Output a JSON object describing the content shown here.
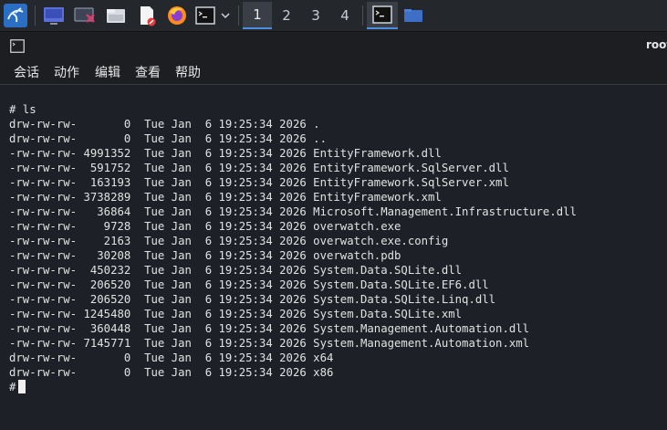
{
  "taskbar": {
    "apps": [
      {
        "icon": "kali-menu-icon"
      },
      {
        "icon": "show-desktop-icon"
      },
      {
        "icon": "screenshot-icon"
      },
      {
        "icon": "file-manager-icon"
      },
      {
        "icon": "text-editor-icon"
      },
      {
        "icon": "firefox-icon"
      },
      {
        "icon": "terminal-icon"
      },
      {
        "icon": "chevron-down-icon"
      }
    ],
    "workspaces": [
      "1",
      "2",
      "3",
      "4"
    ],
    "active_workspace": "1"
  },
  "window": {
    "title": "root"
  },
  "menu": [
    "会话",
    "动作",
    "编辑",
    "查看",
    "帮助"
  ],
  "terminal": {
    "command_line": "# ls",
    "rows": [
      {
        "perm": "drw-rw-rw-",
        "size": "0",
        "day": "Tue",
        "month": "Jan",
        "date": "6",
        "time": "19:25:34",
        "year": "2026",
        "name": "."
      },
      {
        "perm": "drw-rw-rw-",
        "size": "0",
        "day": "Tue",
        "month": "Jan",
        "date": "6",
        "time": "19:25:34",
        "year": "2026",
        "name": ".."
      },
      {
        "perm": "-rw-rw-rw-",
        "size": "4991352",
        "day": "Tue",
        "month": "Jan",
        "date": "6",
        "time": "19:25:34",
        "year": "2026",
        "name": "EntityFramework.dll"
      },
      {
        "perm": "-rw-rw-rw-",
        "size": "591752",
        "day": "Tue",
        "month": "Jan",
        "date": "6",
        "time": "19:25:34",
        "year": "2026",
        "name": "EntityFramework.SqlServer.dll"
      },
      {
        "perm": "-rw-rw-rw-",
        "size": "163193",
        "day": "Tue",
        "month": "Jan",
        "date": "6",
        "time": "19:25:34",
        "year": "2026",
        "name": "EntityFramework.SqlServer.xml"
      },
      {
        "perm": "-rw-rw-rw-",
        "size": "3738289",
        "day": "Tue",
        "month": "Jan",
        "date": "6",
        "time": "19:25:34",
        "year": "2026",
        "name": "EntityFramework.xml"
      },
      {
        "perm": "-rw-rw-rw-",
        "size": "36864",
        "day": "Tue",
        "month": "Jan",
        "date": "6",
        "time": "19:25:34",
        "year": "2026",
        "name": "Microsoft.Management.Infrastructure.dll"
      },
      {
        "perm": "-rw-rw-rw-",
        "size": "9728",
        "day": "Tue",
        "month": "Jan",
        "date": "6",
        "time": "19:25:34",
        "year": "2026",
        "name": "overwatch.exe"
      },
      {
        "perm": "-rw-rw-rw-",
        "size": "2163",
        "day": "Tue",
        "month": "Jan",
        "date": "6",
        "time": "19:25:34",
        "year": "2026",
        "name": "overwatch.exe.config"
      },
      {
        "perm": "-rw-rw-rw-",
        "size": "30208",
        "day": "Tue",
        "month": "Jan",
        "date": "6",
        "time": "19:25:34",
        "year": "2026",
        "name": "overwatch.pdb"
      },
      {
        "perm": "-rw-rw-rw-",
        "size": "450232",
        "day": "Tue",
        "month": "Jan",
        "date": "6",
        "time": "19:25:34",
        "year": "2026",
        "name": "System.Data.SQLite.dll"
      },
      {
        "perm": "-rw-rw-rw-",
        "size": "206520",
        "day": "Tue",
        "month": "Jan",
        "date": "6",
        "time": "19:25:34",
        "year": "2026",
        "name": "System.Data.SQLite.EF6.dll"
      },
      {
        "perm": "-rw-rw-rw-",
        "size": "206520",
        "day": "Tue",
        "month": "Jan",
        "date": "6",
        "time": "19:25:34",
        "year": "2026",
        "name": "System.Data.SQLite.Linq.dll"
      },
      {
        "perm": "-rw-rw-rw-",
        "size": "1245480",
        "day": "Tue",
        "month": "Jan",
        "date": "6",
        "time": "19:25:34",
        "year": "2026",
        "name": "System.Data.SQLite.xml"
      },
      {
        "perm": "-rw-rw-rw-",
        "size": "360448",
        "day": "Tue",
        "month": "Jan",
        "date": "6",
        "time": "19:25:34",
        "year": "2026",
        "name": "System.Management.Automation.dll"
      },
      {
        "perm": "-rw-rw-rw-",
        "size": "7145771",
        "day": "Tue",
        "month": "Jan",
        "date": "6",
        "time": "19:25:34",
        "year": "2026",
        "name": "System.Management.Automation.xml"
      },
      {
        "perm": "drw-rw-rw-",
        "size": "0",
        "day": "Tue",
        "month": "Jan",
        "date": "6",
        "time": "19:25:34",
        "year": "2026",
        "name": "x64"
      },
      {
        "perm": "drw-rw-rw-",
        "size": "0",
        "day": "Tue",
        "month": "Jan",
        "date": "6",
        "time": "19:25:34",
        "year": "2026",
        "name": "x86"
      }
    ],
    "prompt": "#"
  },
  "colors": {
    "taskbar_bg": "#24272c",
    "terminal_bg": "#1d2026",
    "accent": "#4a8fe0"
  }
}
